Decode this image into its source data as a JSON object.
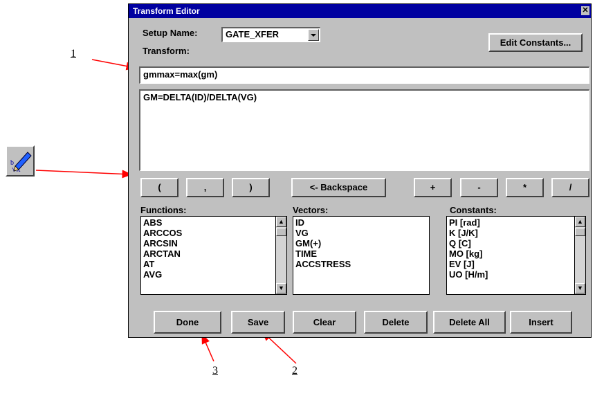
{
  "window": {
    "title": "Transform Editor",
    "close_glyph": "✕"
  },
  "setup": {
    "label": "Setup Name:",
    "value": "GATE_XFER"
  },
  "edit_constants_label": "Edit Constants...",
  "transform": {
    "label": "Transform:",
    "value": "gmmax=max(gm)",
    "text_area": "GM=DELTA(ID)/DELTA(VG)"
  },
  "operator_buttons": [
    "(",
    ",",
    ")",
    "<- Backspace",
    "+",
    "-",
    "*",
    "/"
  ],
  "functions": {
    "label": "Functions:",
    "items": [
      "ABS",
      "ARCCOS",
      "ARCSIN",
      "ARCTAN",
      "AT",
      "AVG"
    ]
  },
  "vectors": {
    "label": "Vectors:",
    "items": [
      "ID",
      "VG",
      "GM(+)",
      "TIME",
      "ACCSTRESS"
    ]
  },
  "constants": {
    "label": "Constants:",
    "items": [
      "PI  [rad]",
      "K  [J/K]",
      "Q  [C]",
      "MO  [kg]",
      "EV  [J]",
      "UO  [H/m]"
    ]
  },
  "bottom_buttons": {
    "done": "Done",
    "save": "Save",
    "clear": "Clear",
    "delete": "Delete",
    "delete_all": "Delete All",
    "insert": "Insert"
  },
  "callouts": {
    "one": "1",
    "two": "2",
    "three": "3"
  },
  "colors": {
    "titlebar": "#0000a0",
    "arrow": "#ff0000",
    "window_bg": "#c0c0c0"
  },
  "icons": {
    "toolbar_icon": "transform-editor-pencil-icon"
  }
}
